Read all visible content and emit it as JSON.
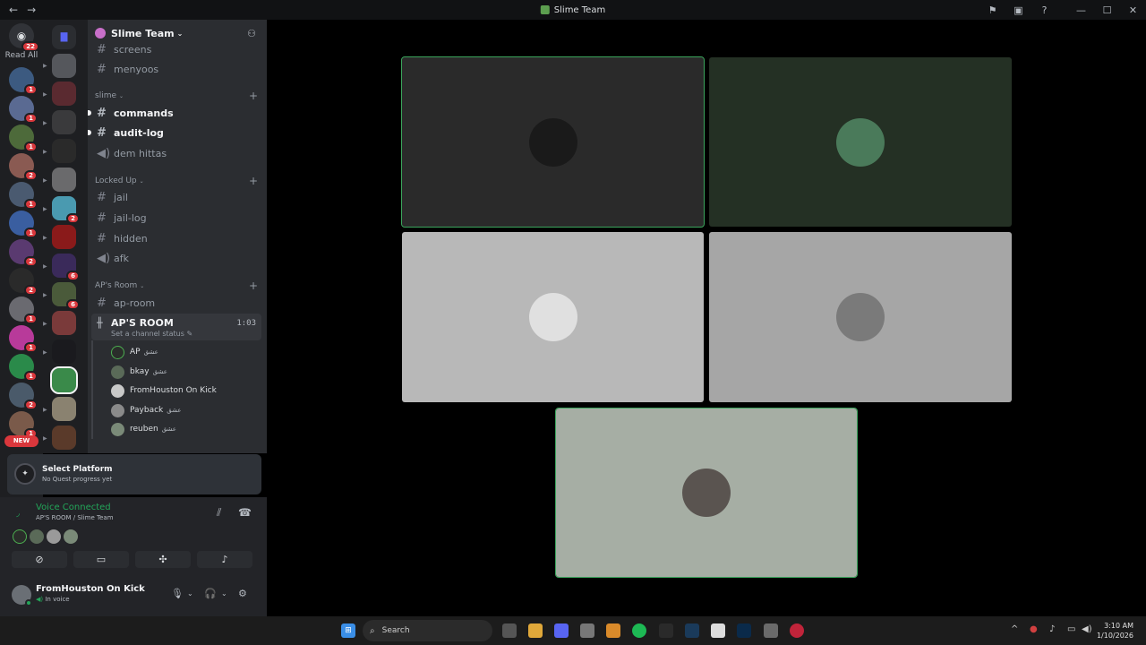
{
  "window": {
    "title": "Slime Team",
    "nav_back": "←",
    "nav_forward": "→",
    "buttons": [
      "⚑",
      "▣",
      "?",
      "—",
      "☐",
      "✕"
    ]
  },
  "rail": {
    "dm_badge": "22",
    "read_all": "Read All",
    "new_label": "NEW",
    "server_badges": [
      "1",
      "1",
      "1",
      "2",
      "1",
      "1",
      "2",
      "2",
      "1",
      "1",
      "1",
      "2",
      "1"
    ]
  },
  "folders": {
    "badges": [
      "2",
      "6",
      "6"
    ]
  },
  "server": {
    "name": "Slime Team",
    "categories": {
      "slime": "slime",
      "locked": "Locked Up",
      "aps": "AP's Room"
    },
    "channels": {
      "screens": "screens",
      "menyoos": "menyoos",
      "commands": "commands",
      "audit_log": "audit-log",
      "dem_hittas": "dem hittas",
      "jail": "jail",
      "jail_log": "jail-log",
      "hidden": "hidden",
      "afk": "afk",
      "ap_room": "ap-room"
    },
    "voice_channel": {
      "name": "AP'S ROOM",
      "timer": "1:03",
      "status": "Set a channel status"
    },
    "members": [
      {
        "name": "AP",
        "tag": "عشق"
      },
      {
        "name": "bkay",
        "tag": "عشق"
      },
      {
        "name": "FromHouston On Kick",
        "tag": ""
      },
      {
        "name": "Payback",
        "tag": "عشق"
      },
      {
        "name": "reuben",
        "tag": "عشق"
      }
    ]
  },
  "quest": {
    "title": "Select Platform",
    "subtitle": "No Quest progress yet"
  },
  "voice": {
    "status": "Voice Connected",
    "location": "AP'S ROOM / Slime Team"
  },
  "user": {
    "name": "FromHouston On Kick",
    "status": "In voice"
  },
  "taskbar": {
    "search_placeholder": "Search",
    "time": "3:10 AM",
    "date": "1/10/2026"
  },
  "colors": {
    "accent_green": "#23a559",
    "speaking_outline": "#3ba55c",
    "badge_red": "#da373c"
  }
}
